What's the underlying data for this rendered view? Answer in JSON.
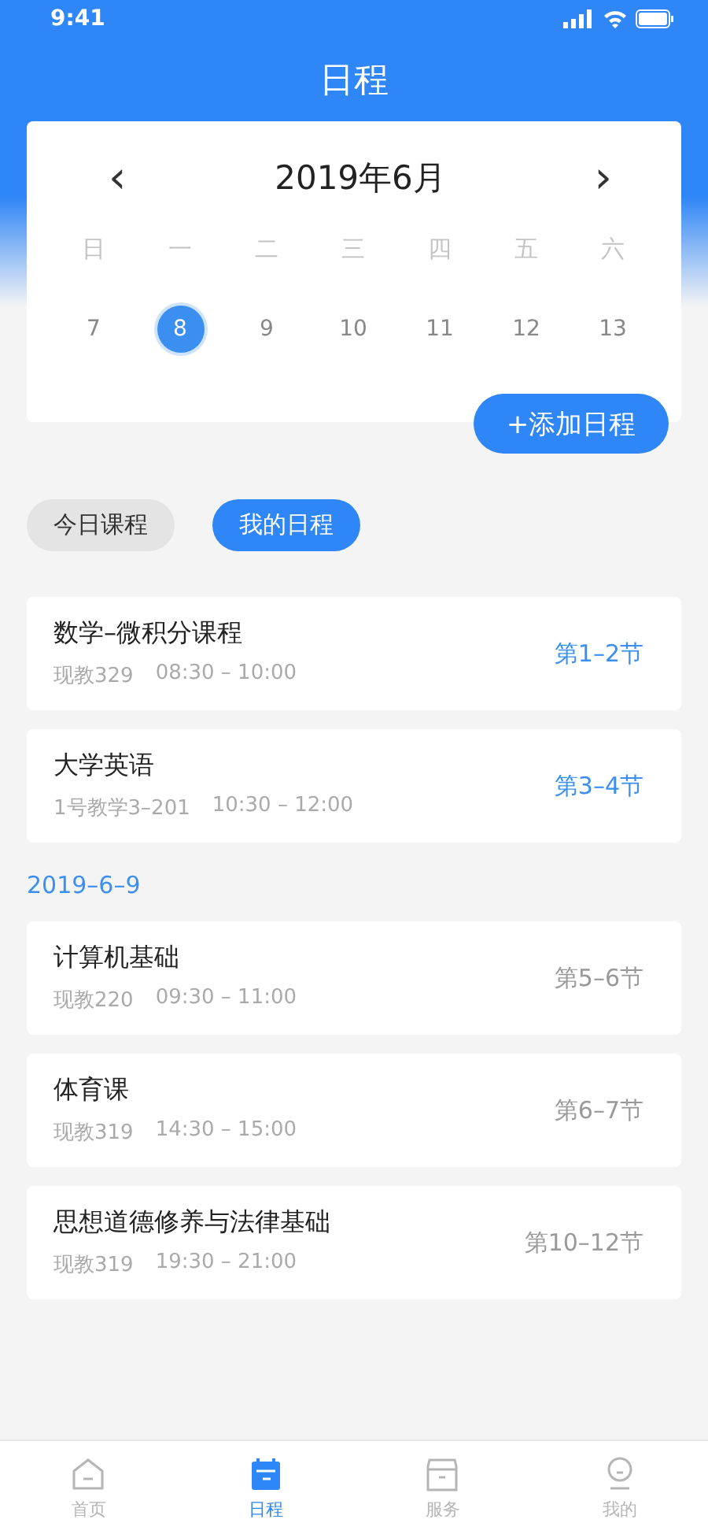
{
  "status_bar": {
    "time": "9:41"
  },
  "title": "日程",
  "calendar": {
    "month": "2019年6月",
    "prev": "‹",
    "next": "›",
    "weekdays": [
      "日",
      "一",
      "二",
      "三",
      "四",
      "五",
      "六"
    ],
    "days": [
      {
        "label": "7",
        "selected": false
      },
      {
        "label": "8",
        "selected": true
      },
      {
        "label": "9",
        "selected": false
      },
      {
        "label": "10",
        "selected": false
      },
      {
        "label": "11",
        "selected": false
      },
      {
        "label": "12",
        "selected": false
      },
      {
        "label": "13",
        "selected": false
      }
    ]
  },
  "add_button": "+添加日程",
  "filters": [
    {
      "label": "今日课程",
      "selected": false
    },
    {
      "label": "我的日程",
      "selected": true
    }
  ],
  "groups": [
    {
      "courses": [
        {
          "name": "数学–微积分课程",
          "room": "现教329",
          "time": "08:30 – 10:00",
          "sections": "第1–2节",
          "current": true
        },
        {
          "name": "大学英语",
          "room": "1号教学3–201",
          "time": "10:30 – 12:00",
          "sections": "第3–4节",
          "current": true
        }
      ]
    },
    {
      "date": "2019–6–9",
      "courses": [
        {
          "name": "计算机基础",
          "room": "现教220",
          "time": "09:30 – 11:00",
          "sections": "第5–6节",
          "current": false
        },
        {
          "name": "体育课",
          "room": "现教319",
          "time": "14:30 – 15:00",
          "sections": "第6–7节",
          "current": false
        },
        {
          "name": "思想道德修养与法律基础",
          "room": "现教319",
          "time": "19:30 – 21:00",
          "sections": "第10–12节",
          "current": false
        }
      ]
    }
  ],
  "tab_bar": [
    {
      "label": "首页",
      "kind": "home",
      "selected": false
    },
    {
      "label": "日程",
      "kind": "calendar",
      "selected": true
    },
    {
      "label": "服务",
      "kind": "box",
      "selected": false
    },
    {
      "label": "我的",
      "kind": "profile",
      "selected": false
    }
  ]
}
